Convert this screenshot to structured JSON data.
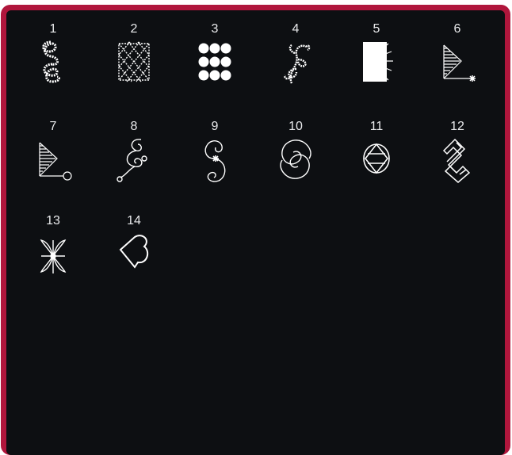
{
  "stitches": [
    {
      "number": "1",
      "icon": "scallop-loops-icon"
    },
    {
      "number": "2",
      "icon": "lattice-diamonds-icon"
    },
    {
      "number": "3",
      "icon": "starburst-grid-icon"
    },
    {
      "number": "4",
      "icon": "vine-leaves-icon"
    },
    {
      "number": "5",
      "icon": "fan-rays-icon"
    },
    {
      "number": "6",
      "icon": "satin-wedge-star-icon"
    },
    {
      "number": "7",
      "icon": "satin-wedge-circle-icon"
    },
    {
      "number": "8",
      "icon": "scroll-curls-icon"
    },
    {
      "number": "9",
      "icon": "s-curl-star-icon"
    },
    {
      "number": "10",
      "icon": "double-curl-icon"
    },
    {
      "number": "11",
      "icon": "diamond-oval-icon"
    },
    {
      "number": "12",
      "icon": "zigzag-blocks-icon"
    },
    {
      "number": "13",
      "icon": "butterfly-icon"
    },
    {
      "number": "14",
      "icon": "heart-outline-icon"
    }
  ],
  "colors": {
    "frame": "#b0163c",
    "panel": "#0d0f12",
    "stitch": "#ffffff"
  }
}
